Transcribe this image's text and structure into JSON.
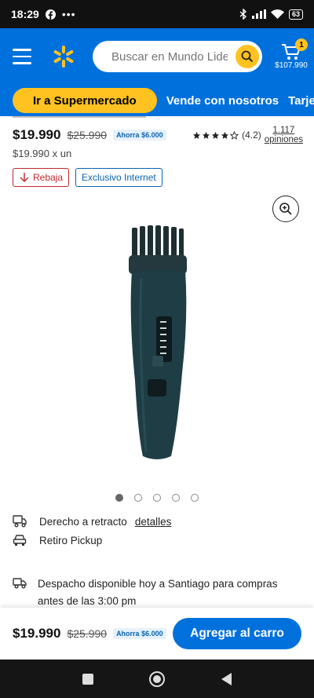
{
  "status_bar": {
    "time": "18:29",
    "battery": "63"
  },
  "header": {
    "search_placeholder": "Buscar en Mundo Lider",
    "cart_count": "1",
    "cart_total": "$107.990",
    "brand_color": "#0071dc",
    "accent_color": "#ffc220"
  },
  "nav": {
    "primary_pill": "Ir a Supermercado",
    "links": [
      "Vende con nosotros",
      "Tarjet"
    ]
  },
  "product": {
    "price": "$19.990",
    "old_price": "$25.990",
    "savings": "Ahorra $6.000",
    "unit_price": "$19.990 x un",
    "rating_value": "(4.2)",
    "rating_stars": 4.2,
    "reviews_count": "1.117",
    "reviews_label": "opiniones",
    "tags": [
      "Rebaja",
      "Exclusivo Internet"
    ],
    "image": "hair-clipper-image",
    "carousel": {
      "count": 5,
      "active": 1
    }
  },
  "info": {
    "retract_label": "Derecho a retracto",
    "retract_link": "detalles",
    "pickup_label": "Retiro Pickup",
    "dispatch_text": "Despacho disponible hoy a Santiago para compras antes de las 3:00 pm"
  },
  "bottom_bar": {
    "price": "$19.990",
    "old_price": "$25.990",
    "savings": "Ahorra $6.000",
    "add_button": "Agregar al carro"
  }
}
